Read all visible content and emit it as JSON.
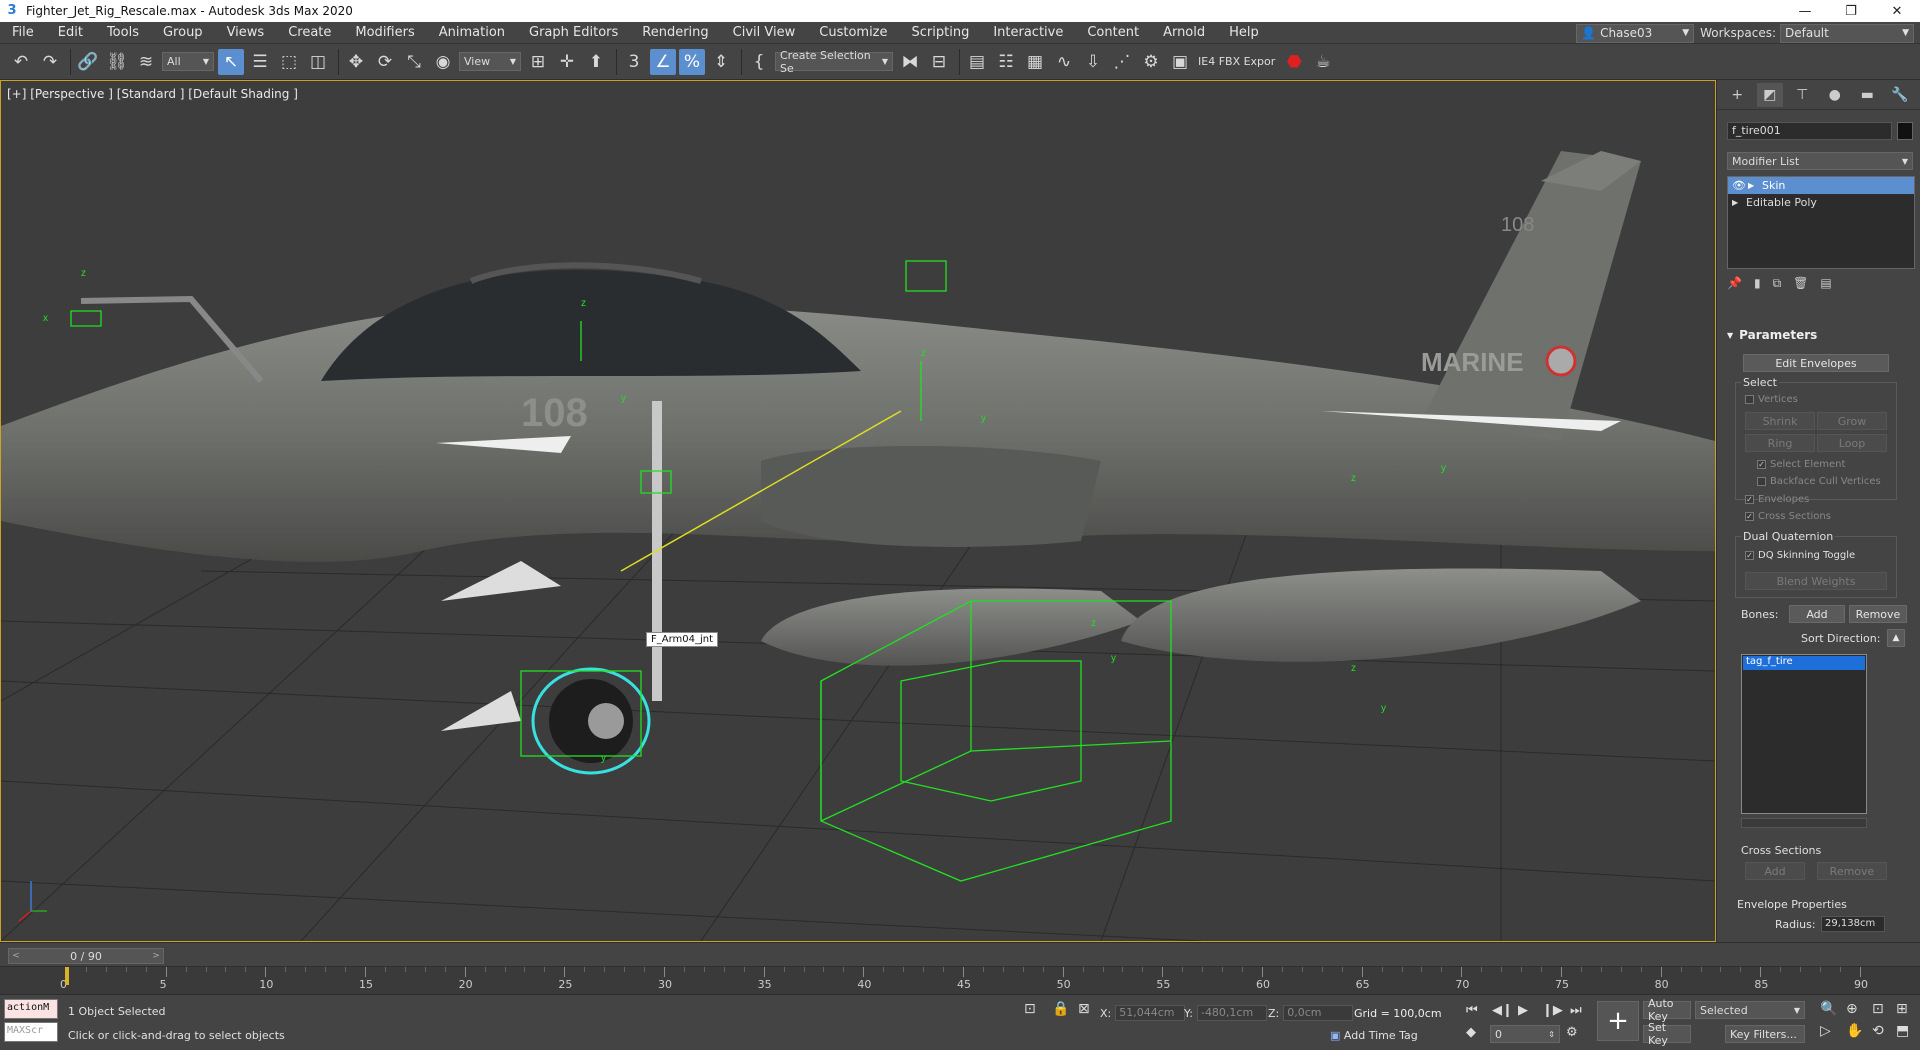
{
  "window": {
    "title": "Fighter_Jet_Rig_Rescale.max - Autodesk 3ds Max 2020",
    "min": "—",
    "max": "❐",
    "close": "✕"
  },
  "menus": [
    "File",
    "Edit",
    "Tools",
    "Group",
    "Views",
    "Create",
    "Modifiers",
    "Animation",
    "Graph Editors",
    "Rendering",
    "Civil View",
    "Customize",
    "Scripting",
    "Interactive",
    "Content",
    "Arnold",
    "Help"
  ],
  "user": {
    "name": "Chase03"
  },
  "workspace": {
    "label": "Workspaces:",
    "value": "Default"
  },
  "toolbar": {
    "filter": "All",
    "refcoord": "View",
    "selection_set": "Create Selection Se",
    "fbx_label": "IE4 FBX Expor"
  },
  "viewport": {
    "label": "[+] [Perspective ] [Standard ] [Default Shading ]",
    "tooltip": "F_Arm04_jnt",
    "markings": {
      "number": "108",
      "tail_number": "108",
      "text": "MARINE"
    },
    "gizmo_z": "z",
    "gizmo_y": "y",
    "gizmo_x": "x"
  },
  "command_panel": {
    "tabs": [
      "create-icon",
      "modify-icon",
      "hierarchy-icon",
      "motion-icon",
      "display-icon",
      "utilities-icon"
    ],
    "object_name": "f_tire001",
    "modifier_list": "Modifier List",
    "stack": [
      {
        "label": "Skin",
        "selected": true
      },
      {
        "label": "Editable Poly",
        "selected": false
      }
    ],
    "parameters": {
      "title": "Parameters",
      "edit_envelopes": "Edit Envelopes",
      "select": "Select",
      "vertices": "Vertices",
      "shrink": "Shrink",
      "grow": "Grow",
      "ring": "Ring",
      "loop": "Loop",
      "select_element": "Select Element",
      "backface": "Backface Cull Vertices",
      "envelopes": "Envelopes",
      "cross_sections": "Cross Sections",
      "dual_quaternion": "Dual Quaternion",
      "dq_toggle": "DQ Skinning Toggle",
      "blend_weights": "Blend Weights",
      "bones": "Bones:",
      "add": "Add",
      "remove": "Remove",
      "sort_direction": "Sort Direction:",
      "bone_items": [
        "tag_f_tire"
      ],
      "cross_sections_group": "Cross Sections",
      "cs_add": "Add",
      "cs_remove": "Remove",
      "envelope_props": "Envelope Properties",
      "radius_label": "Radius:",
      "radius_value": "29,138cm"
    }
  },
  "timeline": {
    "slider": "0 / 90",
    "ticks": [
      "0",
      "5",
      "10",
      "15",
      "20",
      "25",
      "30",
      "35",
      "40",
      "45",
      "50",
      "55",
      "60",
      "65",
      "70",
      "75",
      "80",
      "85",
      "90"
    ]
  },
  "status": {
    "maxscript1": "actionM",
    "maxscript2": "MAXScr",
    "line1": "1 Object Selected",
    "line2": "Click or click-and-drag to select objects",
    "x_label": "X:",
    "x": "51,044cm",
    "y_label": "Y:",
    "y": "-480,1cm",
    "z_label": "Z:",
    "z": "0,0cm",
    "grid": "Grid = 100,0cm",
    "add_time_tag": "Add Time Tag",
    "auto_key": "Auto Key",
    "selected": "Selected",
    "set_key": "Set Key",
    "key_filters": "Key Filters...",
    "frame": "0"
  },
  "colors": {
    "accent": "#5b8fd0",
    "viewport_border": "#c9a227",
    "helper_green": "#22e022",
    "selection_list": "#1e6fd9"
  }
}
